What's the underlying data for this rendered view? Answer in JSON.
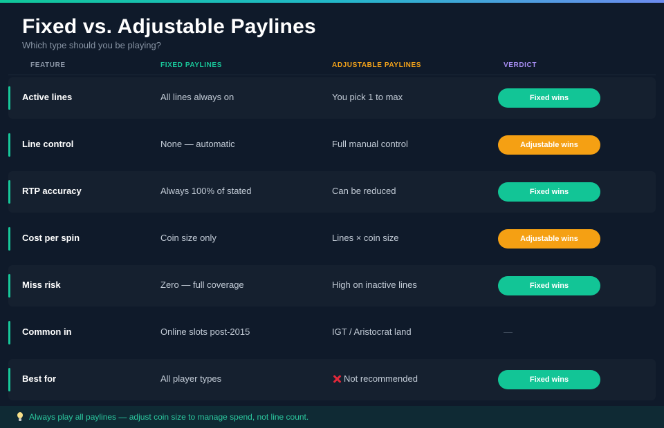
{
  "header": {
    "title": "Fixed vs. Adjustable Paylines",
    "subtitle": "Which type should you be playing?"
  },
  "columns": {
    "feature": "FEATURE",
    "fixed": "FIXED PAYLINES",
    "adjustable": "ADJUSTABLE PAYLINES",
    "verdict": "VERDICT"
  },
  "colors": {
    "fixed_accent": "#12c596",
    "adjustable_accent": "#f5a013",
    "verdict_accent": "#a58cf0",
    "background": "#0f1a2a"
  },
  "rows": [
    {
      "feature": "Active lines",
      "fixed": "All lines always on",
      "adjustable": "You pick 1 to max",
      "verdict": "Fixed wins",
      "verdict_type": "fixed"
    },
    {
      "feature": "Line control",
      "fixed": "None — automatic",
      "adjustable": "Full manual control",
      "verdict": "Adjustable wins",
      "verdict_type": "adjustable"
    },
    {
      "feature": "RTP accuracy",
      "fixed": "Always 100% of stated",
      "adjustable": "Can be reduced",
      "verdict": "Fixed wins",
      "verdict_type": "fixed"
    },
    {
      "feature": "Cost per spin",
      "fixed": "Coin size only",
      "adjustable": "Lines × coin size",
      "verdict": "Adjustable wins",
      "verdict_type": "adjustable"
    },
    {
      "feature": "Miss risk",
      "fixed": "Zero — full coverage",
      "adjustable": "High on inactive lines",
      "verdict": "Fixed wins",
      "verdict_type": "fixed"
    },
    {
      "feature": "Common in",
      "fixed": "Online slots post-2015",
      "adjustable": "IGT / Aristocrat land",
      "verdict": "—",
      "verdict_type": "none"
    },
    {
      "feature": "Best for",
      "fixed": "All player types",
      "adjustable": "Not recommended",
      "adjustable_icon": "cross-mark-icon",
      "verdict": "Fixed wins",
      "verdict_type": "fixed"
    }
  ],
  "footer": {
    "icon": "lightbulb-icon",
    "text": "Always play all paylines — adjust coin size to manage spend, not line count."
  }
}
